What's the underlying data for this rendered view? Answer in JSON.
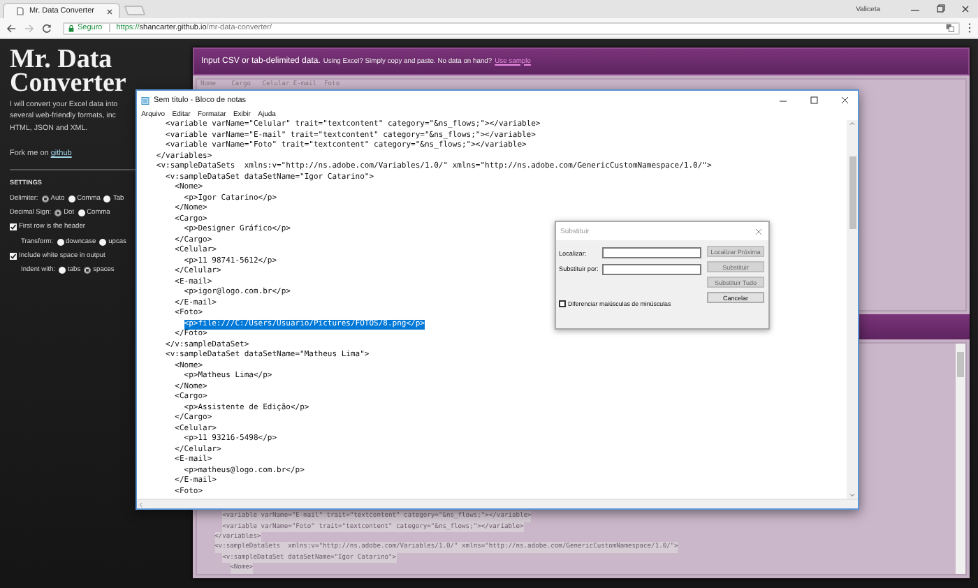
{
  "browser": {
    "tab": {
      "title": "Mr. Data Converter"
    },
    "profile": "Valiceta",
    "address": {
      "security": "Seguro",
      "url": "https://shancarter.github.io/mr-data-converter/"
    }
  },
  "sidebar": {
    "title": "Mr. Data Converter",
    "description": [
      "I will convert your Excel data into",
      "several web-friendly formats, inc",
      "HTML, JSON and XML."
    ],
    "fork": {
      "text": "Fork me on ",
      "link": "github"
    },
    "settings": {
      "title": "SETTINGS",
      "rows": [
        {
          "kind": "radio",
          "label": "Delimiter:",
          "indented": false,
          "options": [
            {
              "label": "Auto",
              "selected": true
            },
            {
              "label": "Comma",
              "selected": false
            },
            {
              "label": "Tab",
              "selected": false
            }
          ]
        },
        {
          "kind": "radio",
          "label": "Decimal Sign:",
          "indented": false,
          "options": [
            {
              "label": "Dot",
              "selected": true
            },
            {
              "label": "Comma",
              "selected": false
            }
          ]
        },
        {
          "kind": "checkbox",
          "label": "First row is the header",
          "indented": false,
          "checked": true
        },
        {
          "kind": "radio",
          "label": "Transform:",
          "indented": true,
          "options": [
            {
              "label": "downcase",
              "selected": false
            },
            {
              "label": "upcas",
              "selected": false
            }
          ]
        },
        {
          "kind": "checkbox",
          "label": "Include white space in output",
          "indented": false,
          "checked": true
        },
        {
          "kind": "radio",
          "label": "Indent with:",
          "indented": true,
          "options": [
            {
              "label": "tabs",
              "selected": false
            },
            {
              "label": "spaces",
              "selected": true
            }
          ]
        }
      ]
    }
  },
  "input_panel": {
    "heading": "Input CSV or tab-delimited data.",
    "hint": "Using Excel? Simply copy and paste. No data on hand?",
    "link": "Use sample",
    "text": "Nome\tCargo\tCelular\tE-mail\tFoto"
  },
  "output_panel": {
    "lines": [
      "    <variable varName=\"E-mail\" trait=\"textcontent\" category=\"&ns_flows;\"></variable>",
      "    <variable varName=\"Foto\" trait=\"textcontent\" category=\"&ns_flows;\"></variable>",
      "  </variables>",
      "  <v:sampleDataSets  xmlns:v=\"http://ns.adobe.com/Variables/1.0/\" xmlns=\"http://ns.adobe.com/GenericCustomNamespace/1.0/\">",
      "    <v:sampleDataSet dataSetName=\"Igor Catarino\">",
      "      <Nome>"
    ]
  },
  "notepad": {
    "title": "Sem título - Bloco de notas",
    "menu": [
      "Arquivo",
      "Editar",
      "Formatar",
      "Exibir",
      "Ajuda"
    ],
    "lines": [
      {
        "text": "    <variable varName=\"Celular\" trait=\"textcontent\" category=\"&ns_flows;\"></variable>",
        "selected": false
      },
      {
        "text": "    <variable varName=\"E-mail\" trait=\"textcontent\" category=\"&ns_flows;\"></variable>",
        "selected": false
      },
      {
        "text": "    <variable varName=\"Foto\" trait=\"textcontent\" category=\"&ns_flows;\"></variable>",
        "selected": false
      },
      {
        "text": "  </variables>",
        "selected": false
      },
      {
        "text": "  <v:sampleDataSets  xmlns:v=\"http://ns.adobe.com/Variables/1.0/\" xmlns=\"http://ns.adobe.com/GenericCustomNamespace/1.0/\">",
        "selected": false
      },
      {
        "text": "    <v:sampleDataSet dataSetName=\"Igor Catarino\">",
        "selected": false
      },
      {
        "text": "      <Nome>",
        "selected": false
      },
      {
        "text": "        <p>Igor Catarino</p>",
        "selected": false
      },
      {
        "text": "      </Nome>",
        "selected": false
      },
      {
        "text": "      <Cargo>",
        "selected": false
      },
      {
        "text": "        <p>Designer Gráfico</p>",
        "selected": false
      },
      {
        "text": "      </Cargo>",
        "selected": false
      },
      {
        "text": "      <Celular>",
        "selected": false
      },
      {
        "text": "        <p>11 98741-5612</p>",
        "selected": false
      },
      {
        "text": "      </Celular>",
        "selected": false
      },
      {
        "text": "      <E-mail>",
        "selected": false
      },
      {
        "text": "        <p>igor@logo.com.br</p>",
        "selected": false
      },
      {
        "text": "      </E-mail>",
        "selected": false
      },
      {
        "text": "      <Foto>",
        "selected": false
      },
      {
        "text": "        <p>file:///C:/Users/Usuario/Pictures/FOTOS/8.png</p>",
        "selected": true
      },
      {
        "text": "      </Foto>",
        "selected": false
      },
      {
        "text": "    </v:sampleDataSet>",
        "selected": false
      },
      {
        "text": "    <v:sampleDataSet dataSetName=\"Matheus Lima\">",
        "selected": false
      },
      {
        "text": "      <Nome>",
        "selected": false
      },
      {
        "text": "        <p>Matheus Lima</p>",
        "selected": false
      },
      {
        "text": "      </Nome>",
        "selected": false
      },
      {
        "text": "      <Cargo>",
        "selected": false
      },
      {
        "text": "        <p>Assistente de Edição</p>",
        "selected": false
      },
      {
        "text": "      </Cargo>",
        "selected": false
      },
      {
        "text": "      <Celular>",
        "selected": false
      },
      {
        "text": "        <p>11 93216-5498</p>",
        "selected": false
      },
      {
        "text": "      </Celular>",
        "selected": false
      },
      {
        "text": "      <E-mail>",
        "selected": false
      },
      {
        "text": "        <p>matheus@logo.com.br</p>",
        "selected": false
      },
      {
        "text": "      </E-mail>",
        "selected": false
      },
      {
        "text": "      <Foto>",
        "selected": false
      }
    ]
  },
  "replace_dialog": {
    "title": "Substituir",
    "fields": [
      {
        "label": "Localizar:"
      },
      {
        "label": "Substituir por:"
      }
    ],
    "buttons": [
      {
        "label": "Localizar Próxima",
        "disabled": true
      },
      {
        "label": "Substituir",
        "disabled": true
      },
      {
        "label": "Substituir Tudo",
        "disabled": true
      },
      {
        "label": "Cancelar",
        "disabled": false
      }
    ],
    "checkbox": {
      "label": "Diferenciar maiúsculas de minúsculas",
      "checked": false
    }
  }
}
